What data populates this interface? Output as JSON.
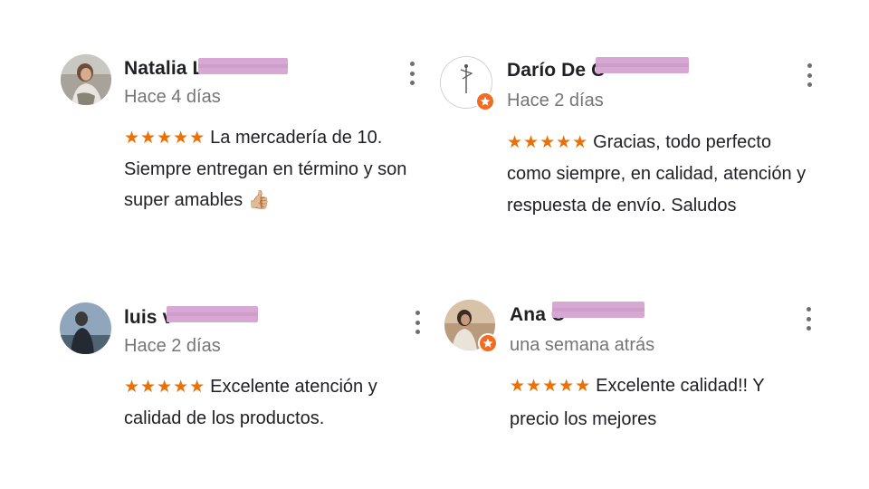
{
  "reviews": [
    {
      "name": "Natalia L",
      "date": "Hace 4 días",
      "stars": "★★★★★",
      "text": "La mercadería de 10. Siempre entregan en término y son super amables 👍🏼",
      "avatar": "photo",
      "local_guide": false
    },
    {
      "name": "Darío De C",
      "date": "Hace 2 días",
      "stars": "★★★★★",
      "text": "Gracias, todo perfecto como siempre, en calidad, atención y respuesta de envío. Saludos",
      "avatar": "drawing",
      "local_guide": true
    },
    {
      "name": "luis v",
      "date": "Hace 2 días",
      "stars": "★★★★★",
      "text": "Excelente atención y calidad de los productos.",
      "avatar": "photo",
      "local_guide": false
    },
    {
      "name": "Ana C",
      "date": "una semana atrás",
      "stars": "★★★★★",
      "text": "Excelente calidad!! Y precio los mejores",
      "avatar": "photo",
      "local_guide": true
    }
  ],
  "colors": {
    "star": "#e8710a",
    "badge": "#f26b21",
    "redaction": "#d7a8d4",
    "date": "#757575"
  },
  "icons": {
    "more": "more-vertical-icon",
    "badge": "local-guide-star-icon"
  }
}
